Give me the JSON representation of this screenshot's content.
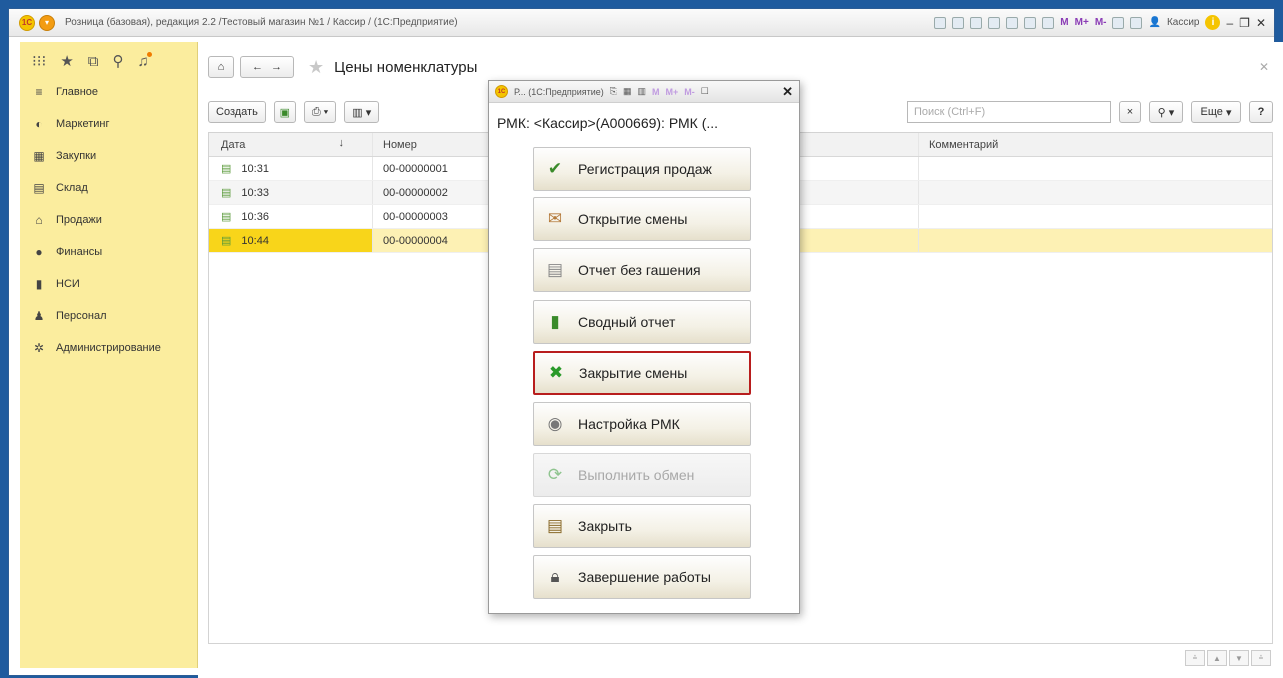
{
  "window": {
    "title": "Розница (базовая), редакция 2.2 /Тестовый магазин №1 / Кассир /  (1С:Предприятие)",
    "logo": "1С",
    "user": "Кассир",
    "m_labels": [
      "M",
      "M+",
      "M-"
    ]
  },
  "sidebar": {
    "items": [
      {
        "label": "Главное",
        "icon": "menu-lines-icon"
      },
      {
        "label": "Маркетинг",
        "icon": "marketing-icon"
      },
      {
        "label": "Закупки",
        "icon": "purchases-icon"
      },
      {
        "label": "Склад",
        "icon": "warehouse-icon"
      },
      {
        "label": "Продажи",
        "icon": "basket-icon"
      },
      {
        "label": "Финансы",
        "icon": "finance-icon"
      },
      {
        "label": "НСИ",
        "icon": "catalog-icon"
      },
      {
        "label": "Персонал",
        "icon": "person-icon"
      },
      {
        "label": "Администрирование",
        "icon": "gear-icon"
      }
    ]
  },
  "page": {
    "title": "Цены номенклатуры",
    "create_label": "Создать",
    "search_placeholder": "Поиск (Ctrl+F)",
    "more_label": "Еще",
    "help_label": "?"
  },
  "table": {
    "columns": [
      "Дата",
      "Номер",
      "Комментарий"
    ],
    "rows": [
      {
        "time": "10:31",
        "number": "00-00000001",
        "comment": ""
      },
      {
        "time": "10:33",
        "number": "00-00000002",
        "comment": ""
      },
      {
        "time": "10:36",
        "number": "00-00000003",
        "comment": ""
      },
      {
        "time": "10:44",
        "number": "00-00000004",
        "comment": ""
      }
    ],
    "selected_index": 3
  },
  "popup": {
    "window_title": "Р...  (1С:Предприятие)",
    "header": "РМК: <Кассир>(А000669): РМК (...",
    "buttons": [
      {
        "label": "Регистрация продаж",
        "icon": "sales-register-icon",
        "state": "normal"
      },
      {
        "label": "Открытие смены",
        "icon": "shift-open-icon",
        "state": "normal"
      },
      {
        "label": "Отчет без гашения",
        "icon": "report-icon",
        "state": "normal"
      },
      {
        "label": "Сводный отчет",
        "icon": "summary-report-icon",
        "state": "normal"
      },
      {
        "label": "Закрытие смены",
        "icon": "shift-close-icon",
        "state": "active"
      },
      {
        "label": "Настройка РМК",
        "icon": "settings-disc-icon",
        "state": "normal"
      },
      {
        "label": "Выполнить обмен",
        "icon": "exchange-icon",
        "state": "disabled"
      },
      {
        "label": "Закрыть",
        "icon": "close-doc-icon",
        "state": "normal"
      },
      {
        "label": "Завершение работы",
        "icon": "lock-icon",
        "state": "normal"
      }
    ]
  },
  "colors": {
    "sidebar_bg": "#fbed9e",
    "selected_row": "#f8d51a",
    "active_button_border": "#b81d1d",
    "frame": "#1f5b9e"
  }
}
